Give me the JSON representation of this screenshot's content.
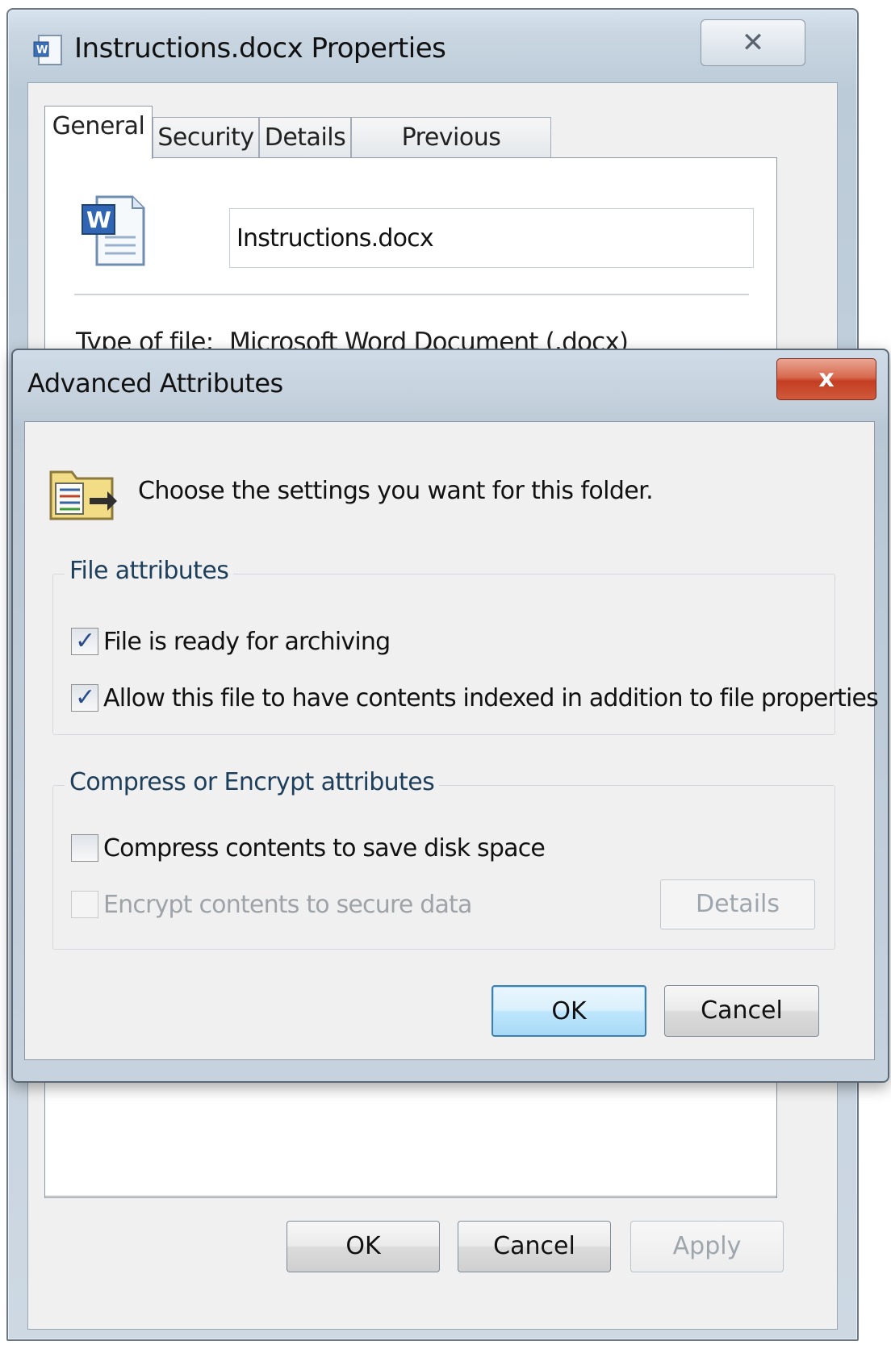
{
  "properties_window": {
    "title": "Instructions.docx Properties",
    "close_glyph": "✕",
    "tabs": [
      {
        "label": "General",
        "active": true
      },
      {
        "label": "Security",
        "active": false
      },
      {
        "label": "Details",
        "active": false
      },
      {
        "label": "Previous Versions",
        "active": false
      }
    ],
    "file_icon": "word-document-icon",
    "filename": "Instructions.docx",
    "type_of_file_label": "Type of file:",
    "type_of_file_value": "Microsoft Word Document (.docx)",
    "buttons": {
      "ok": "OK",
      "cancel": "Cancel",
      "apply": "Apply"
    }
  },
  "advanced_attributes": {
    "title": "Advanced Attributes",
    "close_glyph": "x",
    "icon": "folder-settings-icon",
    "heading": "Choose the settings you want for this folder.",
    "file_attributes": {
      "legend": "File attributes",
      "options": [
        {
          "label": "File is ready for archiving",
          "checked": true,
          "enabled": true
        },
        {
          "label": "Allow this file to have contents indexed in addition to file properties",
          "checked": true,
          "enabled": true
        }
      ]
    },
    "compress_encrypt": {
      "legend": "Compress or Encrypt attributes",
      "options": [
        {
          "label": "Compress contents to save disk space",
          "checked": false,
          "enabled": true
        },
        {
          "label": "Encrypt contents to secure data",
          "checked": false,
          "enabled": false
        }
      ],
      "details_button": "Details"
    },
    "buttons": {
      "ok": "OK",
      "cancel": "Cancel"
    },
    "check_glyph": "✓"
  },
  "colors": {
    "close_button_red": "#c43d22",
    "default_button_blue": "#3c7fb1",
    "group_legend_text": "#1e3f5c"
  }
}
